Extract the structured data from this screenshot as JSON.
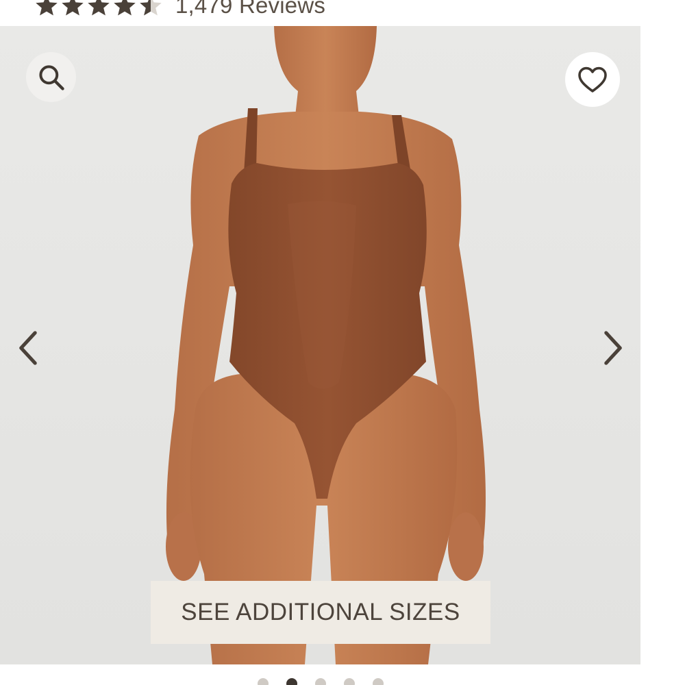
{
  "rating": {
    "stars_value": 4.5,
    "stars_max": 5,
    "reviews_text": "1,479 Reviews"
  },
  "gallery": {
    "sizes_button_label": "SEE ADDITIONAL SIZES",
    "search_icon": "search-icon",
    "favorite_icon": "heart-icon",
    "prev_icon": "chevron-left-icon",
    "next_icon": "chevron-right-icon",
    "dot_count": 5,
    "active_dot": 2
  },
  "colors": {
    "garment": "#8e4f2e",
    "background": "#e8e8e6",
    "button_bg": "#efebe4",
    "text": "#4d443c"
  }
}
